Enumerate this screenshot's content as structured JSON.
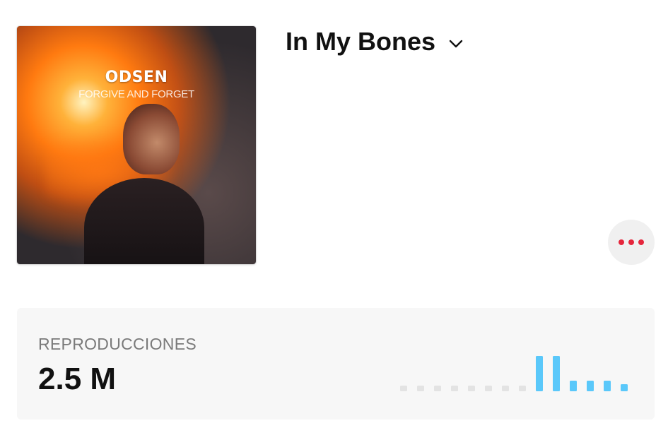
{
  "artwork": {
    "artist": "ODSEN",
    "album": "FORGIVE AND FORGET"
  },
  "song": {
    "title": "In My Bones",
    "dropdown_icon": "chevron-down-icon"
  },
  "more_button": {
    "icon": "ellipsis-icon",
    "color": "#e5263c"
  },
  "stats": {
    "label": "REPRODUCCIONES",
    "value": "2.5 M",
    "accent_color": "#5ac8fa",
    "empty_color": "#e3e3e3"
  },
  "chart_data": {
    "type": "bar",
    "values": [
      0,
      0,
      0,
      0,
      0,
      0,
      0,
      0,
      1,
      1,
      0.3,
      0.3,
      0.3,
      0.2
    ]
  }
}
